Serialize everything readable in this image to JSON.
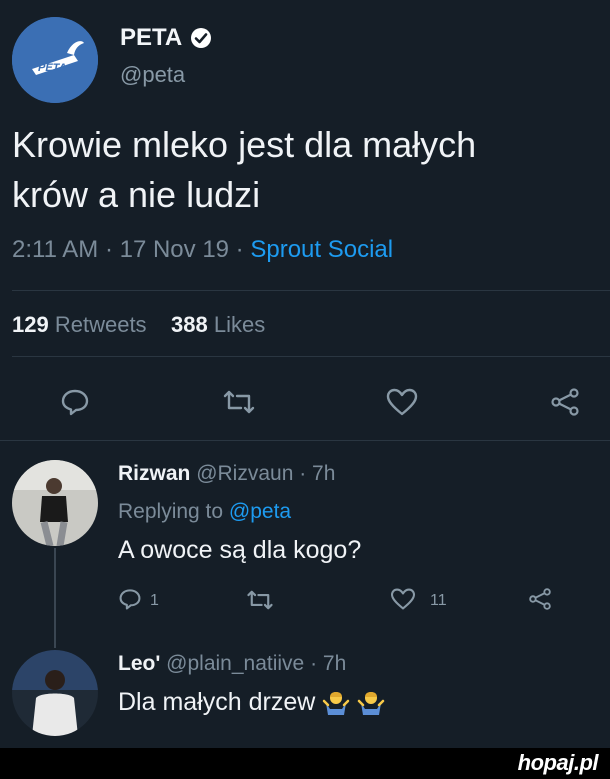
{
  "tweet": {
    "author_name": "PETA",
    "author_handle": "@peta",
    "avatar_text": "PETA",
    "text_line1": "Krowie mleko jest dla małych",
    "text_line2": "krów a nie ludzi",
    "time": "2:11 AM · 17 Nov 19 · ",
    "source": "Sprout Social",
    "retweets_count": "129",
    "retweets_label": "Retweets",
    "likes_count": "388",
    "likes_label": "Likes"
  },
  "replies": [
    {
      "name": "Rizwan",
      "handle": "@Rizvaun · 7h",
      "replying_label": "Replying to ",
      "replying_to": "@peta",
      "text": "A owoce są dla kogo?",
      "reply_count": "1",
      "like_count": "11"
    },
    {
      "name": "Leo'",
      "handle": "@plain_natiive · 7h",
      "text": "Dla małych drzew"
    }
  ],
  "watermark": "hopaj.pl",
  "colors": {
    "background": "#151e27",
    "link": "#1d9bf0",
    "muted": "#7b8b99",
    "avatar_blue": "#3b6fb4"
  },
  "icons": [
    "verified-badge-icon",
    "reply-icon",
    "retweet-icon",
    "like-icon",
    "share-icon",
    "shrug-emoji-icon"
  ]
}
